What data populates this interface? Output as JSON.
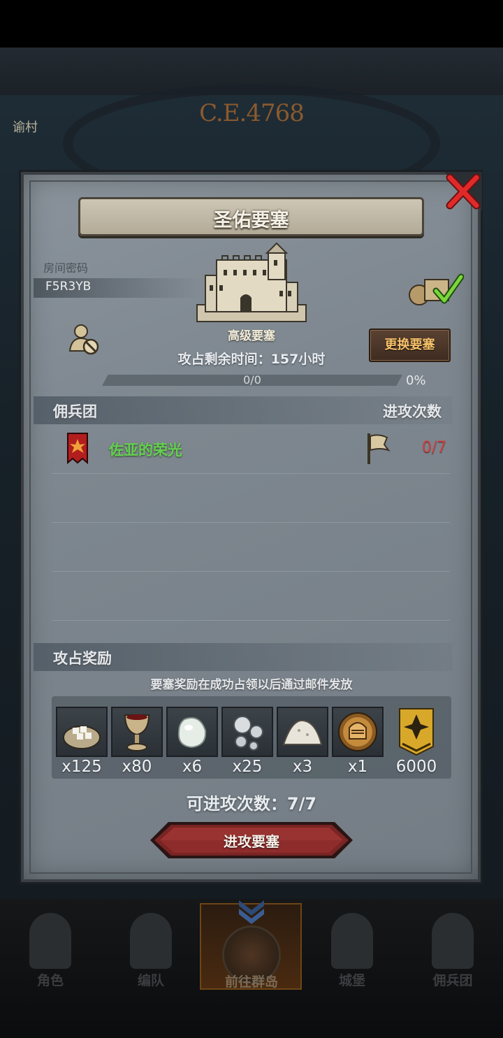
{
  "map": {
    "year_label": "C.E.4768",
    "village_label": "谕村"
  },
  "dialog": {
    "title": "圣佑要塞",
    "room_password_label": "房间密码",
    "room_password": "F5R3YB",
    "fortress_level": "高级要塞",
    "change_fortress_button": "更换要塞",
    "occupy_time_text": "攻占剩余时间：157小时",
    "progress": {
      "text": "0/0",
      "percent_text": "0%",
      "fraction": 0
    },
    "mercenary_header": "佣兵团",
    "attack_count_header": "进攻次数",
    "mercenaries": [
      {
        "name": "佐亚的荣光",
        "attack_count": "0/7"
      }
    ],
    "rewards_header": "攻占奖励",
    "rewards_note": "要塞奖励在成功占领以后通过邮件发放",
    "rewards": [
      {
        "icon": "sugar-sack-icon",
        "qty": "x125"
      },
      {
        "icon": "goblet-icon",
        "qty": "x80"
      },
      {
        "icon": "moonstone-icon",
        "qty": "x6"
      },
      {
        "icon": "silver-pearls-icon",
        "qty": "x25"
      },
      {
        "icon": "salt-pile-icon",
        "qty": "x3"
      },
      {
        "icon": "knight-helmet-medal-icon",
        "qty": "x1"
      },
      {
        "icon": "honor-banner-icon",
        "qty": "6000"
      }
    ],
    "remaining_attacks": "可进攻次数：7/7",
    "attack_button": "进攻要塞"
  },
  "bottom_nav": [
    {
      "label": "角色",
      "icon": "knight-icon",
      "active": false
    },
    {
      "label": "编队",
      "icon": "helmet-icon",
      "active": false
    },
    {
      "label": "前往群岛",
      "icon": "compass-icon",
      "active": true
    },
    {
      "label": "城堡",
      "icon": "castle-icon",
      "active": false
    },
    {
      "label": "佣兵团",
      "icon": "mercenary-icon",
      "active": false
    }
  ],
  "colors": {
    "mercenary_name": "#66d052",
    "attack_count": "#d33f3f",
    "change_button_text": "#f7c16a",
    "attack_button": "#7a2424"
  }
}
